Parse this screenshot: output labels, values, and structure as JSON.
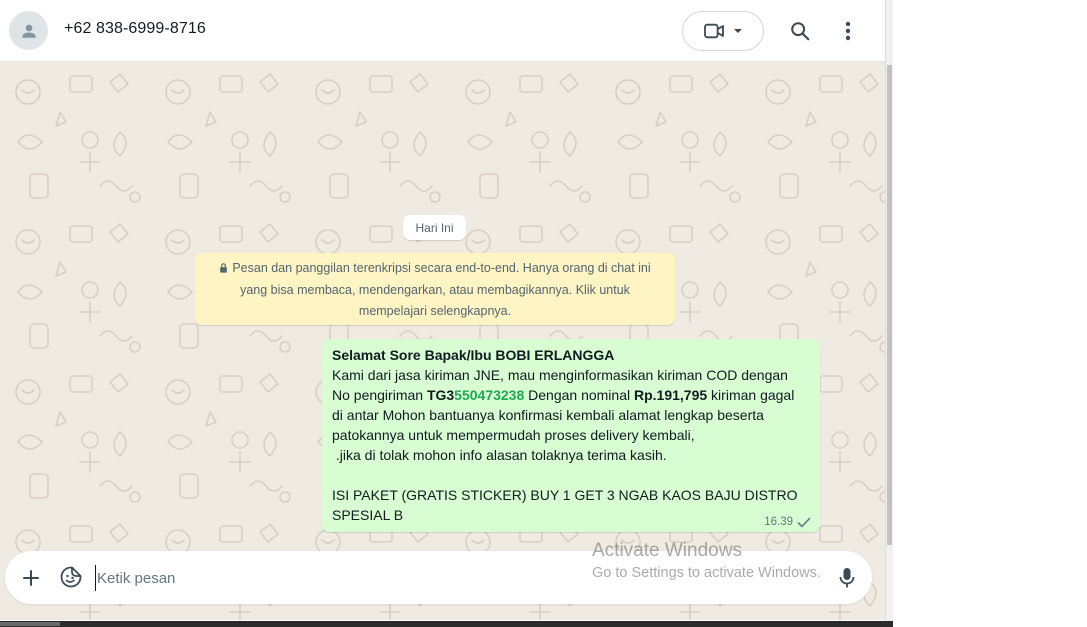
{
  "header": {
    "contact_name": "+62 838-6999-8716",
    "icons": {
      "avatar": "person-icon",
      "video": "video-camera-icon",
      "dropdown": "chevron-down-icon",
      "search": "search-icon",
      "menu": "more-vertical-icon"
    }
  },
  "chat": {
    "date_chip": "Hari Ini",
    "encryption_notice": "Pesan dan panggilan terenkripsi secara end-to-end. Hanya orang di chat ini yang bisa membaca, mendengarkan, atau membagikannya. Klik untuk mempelajari selengkapnya.",
    "message": {
      "greeting": "Selamat Sore Bapak/Ibu BOBI ERLANGGA",
      "line1": "Kami dari jasa kiriman JNE, mau menginformasikan kiriman COD dengan",
      "line2_pre": "No pengiriman ",
      "tracking_prefix": "TG3",
      "tracking_number": "550473238",
      "line2_mid": " Dengan nominal ",
      "amount": "Rp.191,795",
      "line2_post": " kiriman gagal",
      "line3": "di antar Mohon bantuanya konfirmasi kembali alamat lengkap beserta",
      "line4": "patokannya untuk mempermudah proses delivery kembali,",
      "line5": " .jika di tolak mohon info alasan tolaknya terima kasih.",
      "line6": "ISI PAKET (GRATIS STICKER) BUY 1 GET 3 NGAB KAOS BAJU DISTRO",
      "line7": "SPESIAL B",
      "time": "16.39",
      "status_icon": "check-icon"
    }
  },
  "composer": {
    "placeholder": "Ketik pesan",
    "value": "",
    "icons": {
      "attach": "plus-icon",
      "sticker": "sticker-icon",
      "mic": "microphone-icon"
    }
  },
  "watermark": {
    "title": "Activate Windows",
    "subtitle": "Go to Settings to activate Windows."
  },
  "colors": {
    "bubble_out": "#d9fdd3",
    "chat_bg": "#efeae2",
    "notice_bg": "#fff5c4",
    "tracking_highlight": "#1fa855"
  }
}
